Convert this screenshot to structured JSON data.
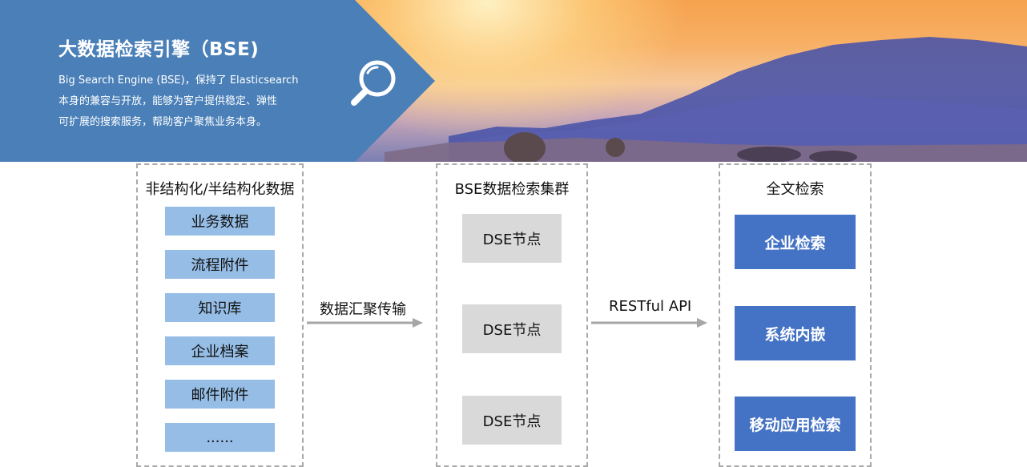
{
  "banner": {
    "title": "大数据检索引擎（BSE)",
    "desc_lines": [
      "Big Search Engine (BSE)，保持了 Elasticsearch",
      "本身的兼容与开放，能够为客户提供稳定、弹性",
      "可扩展的搜索服务，帮助客户聚焦业务本身。"
    ],
    "icon": "search-icon"
  },
  "sources": {
    "title": "非结构化/半结构化数据",
    "items": [
      "业务数据",
      "流程附件",
      "知识库",
      "企业档案",
      "邮件附件",
      "......"
    ]
  },
  "arrow1_label": "数据汇聚传输",
  "cluster": {
    "title": "BSE数据检索集群",
    "nodes": [
      "DSE节点",
      "DSE节点",
      "DSE节点"
    ]
  },
  "arrow2_label": "RESTful API",
  "fulltext": {
    "title": "全文检索",
    "items": [
      "企业检索",
      "系统内嵌",
      "移动应用检索"
    ]
  },
  "colors": {
    "banner_blue": "#4a7fb8",
    "source_item": "#95bde6",
    "node_gray": "#d9d9d9",
    "target_blue": "#4472c4",
    "arrow_gray": "#a6a6a6"
  }
}
